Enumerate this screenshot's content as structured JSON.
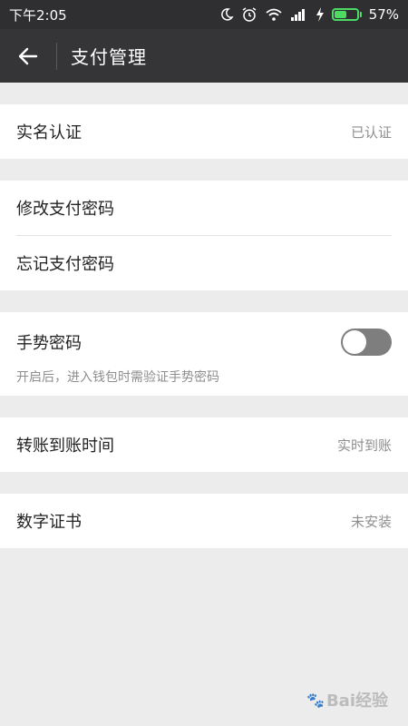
{
  "status_bar": {
    "time": "下午2:05",
    "battery_percent": "57%",
    "battery_level": 0.57,
    "icons": [
      "moon-icon",
      "alarm-icon",
      "wifi-icon",
      "signal-icon",
      "charging-icon",
      "battery-icon"
    ]
  },
  "app_bar": {
    "title": "支付管理",
    "back_icon": "arrow-left-icon"
  },
  "rows": {
    "real_name": {
      "label": "实名认证",
      "value": "已认证"
    },
    "modify_password": {
      "label": "修改支付密码"
    },
    "forgot_password": {
      "label": "忘记支付密码"
    },
    "gesture": {
      "label": "手势密码",
      "description": "开启后，进入钱包时需验证手势密码",
      "enabled": false
    },
    "transfer_time": {
      "label": "转账到账时间",
      "value": "实时到账"
    },
    "certificate": {
      "label": "数字证书",
      "value": "未安装"
    }
  },
  "watermark": {
    "text": "Bai经验"
  },
  "colors": {
    "status_bar_bg": "#2f2f31",
    "app_bar_bg": "#353538",
    "page_bg": "#ececec",
    "battery": "#4cd964",
    "toggle_off": "#7e7e7e"
  }
}
